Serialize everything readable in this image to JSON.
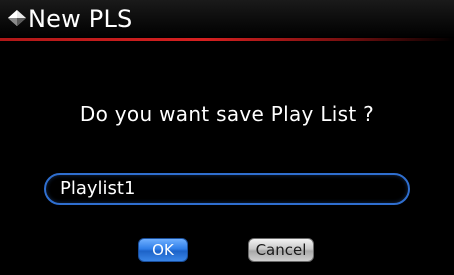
{
  "dialog": {
    "title": "New PLS",
    "title_icon": "playlist-diamond-icon",
    "question": "Do you want save Play List ?",
    "name_input": {
      "value": "Playlist1"
    },
    "buttons": {
      "ok_label": "OK",
      "cancel_label": "Cancel"
    }
  },
  "colors": {
    "background": "#000000",
    "title_underline": "#d62020",
    "field_border": "#2f6fd0",
    "ok_button": "#2f7ee8",
    "cancel_button": "#c9c9c9"
  }
}
